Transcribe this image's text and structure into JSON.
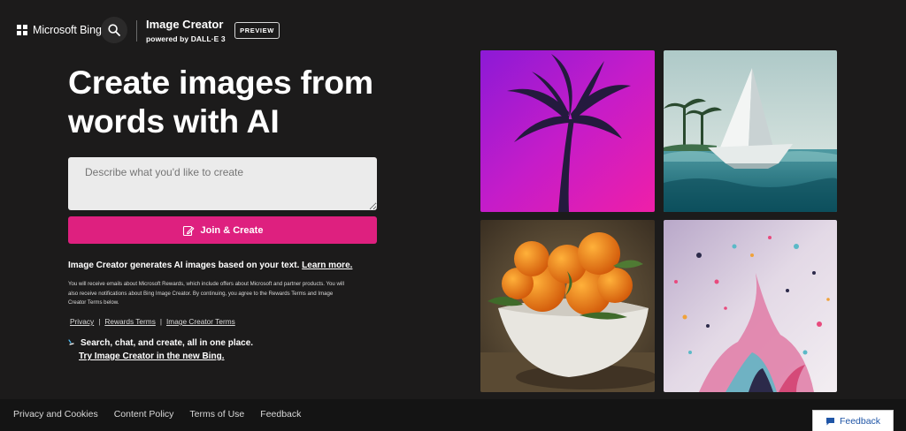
{
  "header": {
    "brand": "Microsoft Bing",
    "product_title": "Image Creator",
    "product_subtitle": "powered by DALL·E 3",
    "preview_badge": "PREVIEW"
  },
  "hero": {
    "title_line1": "Create images from",
    "title_line2": "words with AI"
  },
  "prompt": {
    "placeholder": "Describe what you'd like to create"
  },
  "join_button": {
    "label": "Join & Create"
  },
  "description": {
    "text": "Image Creator generates AI images based on your text.",
    "link": "Learn more."
  },
  "fine_print": "You will receive emails about Microsoft Rewards, which include offers about Microsoft and partner products. You will also receive notifications about Bing Image Creator. By continuing, you agree to the Rewards Terms and Image Creator Terms below.",
  "terms": {
    "privacy": "Privacy",
    "sep": "|",
    "rewards_terms": "Rewards Terms",
    "image_creator_terms": "Image Creator Terms"
  },
  "promo": {
    "line1": "Search, chat, and create, all in one place.",
    "link": "Try Image Creator in the new Bing."
  },
  "gallery": [
    {
      "subject": "palm tree silhouette on magenta"
    },
    {
      "subject": "paper boat on ocean"
    },
    {
      "subject": "oranges in white bowl"
    },
    {
      "subject": "paint splash"
    }
  ],
  "footer": {
    "links": [
      "Privacy and Cookies",
      "Content Policy",
      "Terms of Use",
      "Feedback"
    ],
    "feedback_button": "Feedback"
  },
  "colors": {
    "background": "#1c1b1b",
    "accent": "#de207f",
    "footer": "#141414",
    "link_blue": "#1f55a6"
  },
  "icons": [
    "windows-logo-icon",
    "search-icon",
    "create-pen-icon",
    "sparkle-icon",
    "feedback-icon"
  ]
}
